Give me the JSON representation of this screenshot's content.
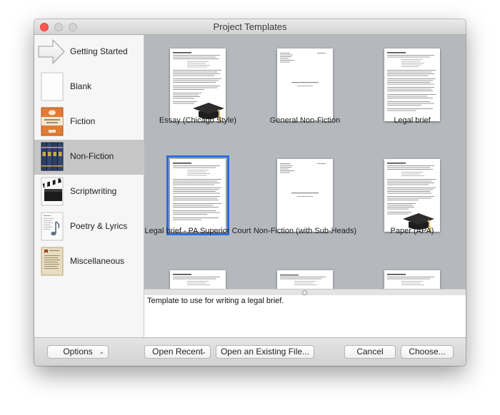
{
  "window": {
    "title": "Project Templates"
  },
  "sidebar": {
    "items": [
      {
        "label": "Getting Started",
        "icon": "arrow-icon"
      },
      {
        "label": "Blank",
        "icon": "blank-page-icon"
      },
      {
        "label": "Fiction",
        "icon": "book-cover-icon"
      },
      {
        "label": "Non-Fiction",
        "icon": "books-icon"
      },
      {
        "label": "Scriptwriting",
        "icon": "clapperboard-icon"
      },
      {
        "label": "Poetry & Lyrics",
        "icon": "music-note-page-icon"
      },
      {
        "label": "Miscellaneous",
        "icon": "parchment-icon"
      }
    ],
    "selected_index": 3
  },
  "templates": {
    "items": [
      {
        "label": "Essay (Chicago Style)",
        "graduation_cap": true
      },
      {
        "label": "General Non-Fiction",
        "graduation_cap": false
      },
      {
        "label": "Legal brief",
        "graduation_cap": false
      },
      {
        "label": "Legal brief - PA Superior Court",
        "graduation_cap": false
      },
      {
        "label": "Non-Fiction (with Sub-Heads)",
        "graduation_cap": false
      },
      {
        "label": "Paper (APA)",
        "graduation_cap": true
      }
    ],
    "selected_index": 3
  },
  "description": "Template to use for writing a legal brief.",
  "footer": {
    "options_label": "Options",
    "open_recent_label": "Open Recent",
    "open_existing_label": "Open an Existing File...",
    "cancel_label": "Cancel",
    "choose_label": "Choose..."
  },
  "colors": {
    "selection_blue": "#2a6dd8",
    "close_red": "#fc5753",
    "grid_bg": "#b5b8bd",
    "sidebar_selected": "#c6c6c6"
  }
}
